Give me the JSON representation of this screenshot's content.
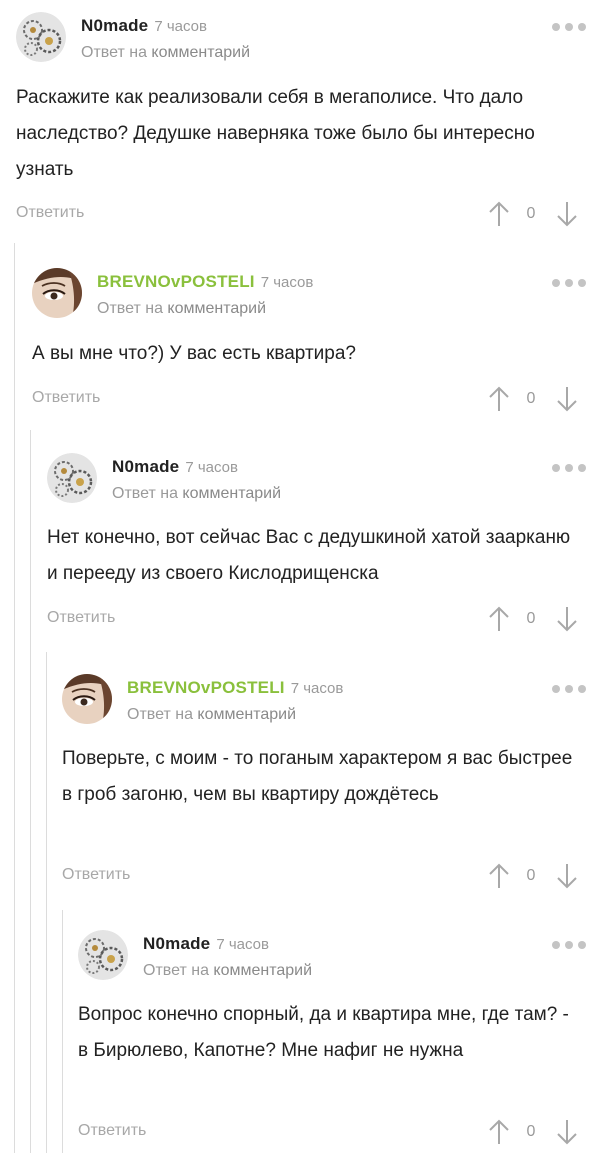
{
  "comments": [
    {
      "author": "N0made",
      "time": "7 часов",
      "reply_prefix": "Ответ на",
      "reply_link": "комментарий",
      "text": "Раскажите как реализовали себя в мегаполисе. Что дало наследство? Дедушке наверняка тоже было бы интересно узнать",
      "reply_label": "Ответить",
      "score": "0",
      "avatar_icon": "gears-avatar",
      "author_color": "#222222"
    },
    {
      "author": "BREVNOvPOSTELI",
      "time": "7 часов",
      "reply_prefix": "Ответ на",
      "reply_link": "комментарий",
      "text": "А вы мне что?) У вас есть квартира?",
      "reply_label": "Ответить",
      "score": "0",
      "avatar_icon": "woman-eye-avatar",
      "author_color": "#8ac03c"
    },
    {
      "author": "N0made",
      "time": "7 часов",
      "reply_prefix": "Ответ на",
      "reply_link": "комментарий",
      "text": "Нет конечно, вот сейчас Вас с дедушкиной хатой заарканю и перееду из своего Кислодрищенска",
      "reply_label": "Ответить",
      "score": "0",
      "avatar_icon": "gears-avatar",
      "author_color": "#222222"
    },
    {
      "author": "BREVNOvPOSTELI",
      "time": "7 часов",
      "reply_prefix": "Ответ на",
      "reply_link": "комментарий",
      "text": "Поверьте, с моим - то поганым характером я вас быстрее в гроб загоню, чем вы квартиру дождётесь",
      "reply_label": "Ответить",
      "score": "0",
      "avatar_icon": "woman-eye-avatar",
      "author_color": "#8ac03c"
    },
    {
      "author": "N0made",
      "time": "7 часов",
      "reply_prefix": "Ответ на",
      "reply_link": "комментарий",
      "text": "Вопрос конечно спорный, да и квартира мне, где там? - в Бирюлево, Капотне? Мне нафиг не нужна",
      "reply_label": "Ответить",
      "score": "0",
      "avatar_icon": "gears-avatar",
      "author_color": "#222222"
    }
  ]
}
